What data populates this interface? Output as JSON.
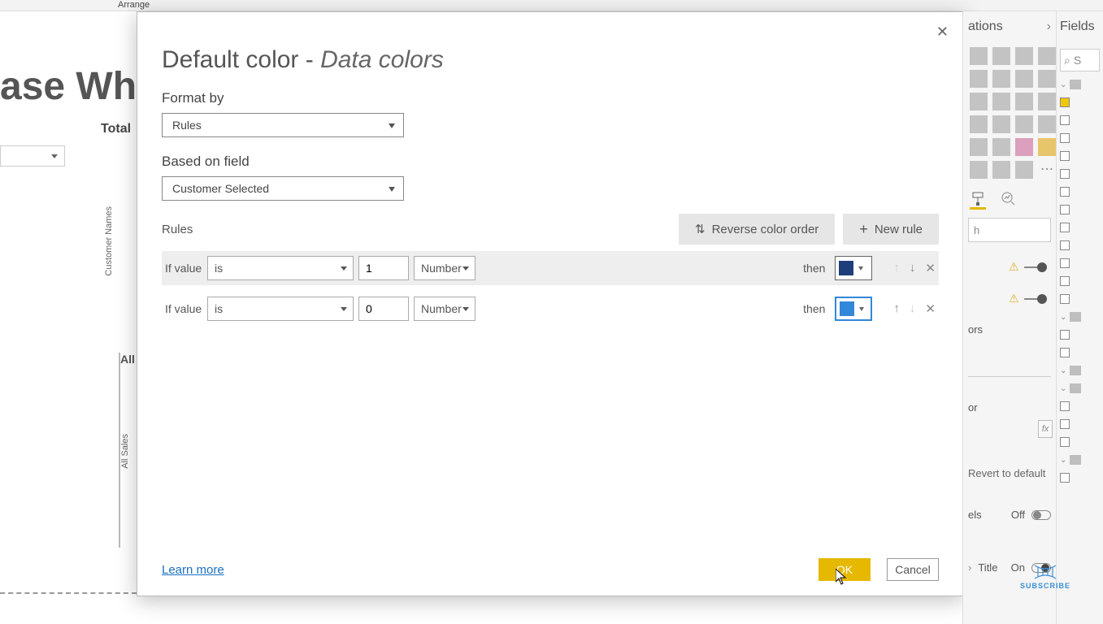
{
  "ribbon": {
    "tab": "Arrange"
  },
  "background": {
    "title": "ase Wher",
    "total": "Total",
    "cust_label": "Customer Names",
    "allsales_label": "All Sales",
    "all_label": "All"
  },
  "dialog": {
    "title_prefix": "Default color - ",
    "title_italic": "Data colors",
    "format_by_label": "Format by",
    "format_by_value": "Rules",
    "based_on_label": "Based on field",
    "based_on_value": "Customer Selected",
    "rules_label": "Rules",
    "reverse_btn": "Reverse color order",
    "new_rule_btn": "New rule",
    "rules": [
      {
        "if_label": "If value",
        "op": "is",
        "value": "1",
        "type": "Number",
        "then_label": "then",
        "color": "#1d3e7a"
      },
      {
        "if_label": "If value",
        "op": "is",
        "value": "0",
        "type": "Number",
        "then_label": "then",
        "color": "#3288d8"
      }
    ],
    "learn_more": "Learn more",
    "ok": "OK",
    "cancel": "Cancel"
  },
  "viz_pane": {
    "title": "ations",
    "search_placeholder": "h",
    "ors_label": "ors",
    "or_label": "or",
    "fx": "fx",
    "revert": "Revert to default",
    "labels_toggle": {
      "label": "els",
      "state": "Off"
    },
    "title_toggle": {
      "label": "Title",
      "state": "On"
    }
  },
  "fields_pane": {
    "title": "Fields",
    "search_text": "S"
  },
  "subscribe": "SUBSCRIBE"
}
